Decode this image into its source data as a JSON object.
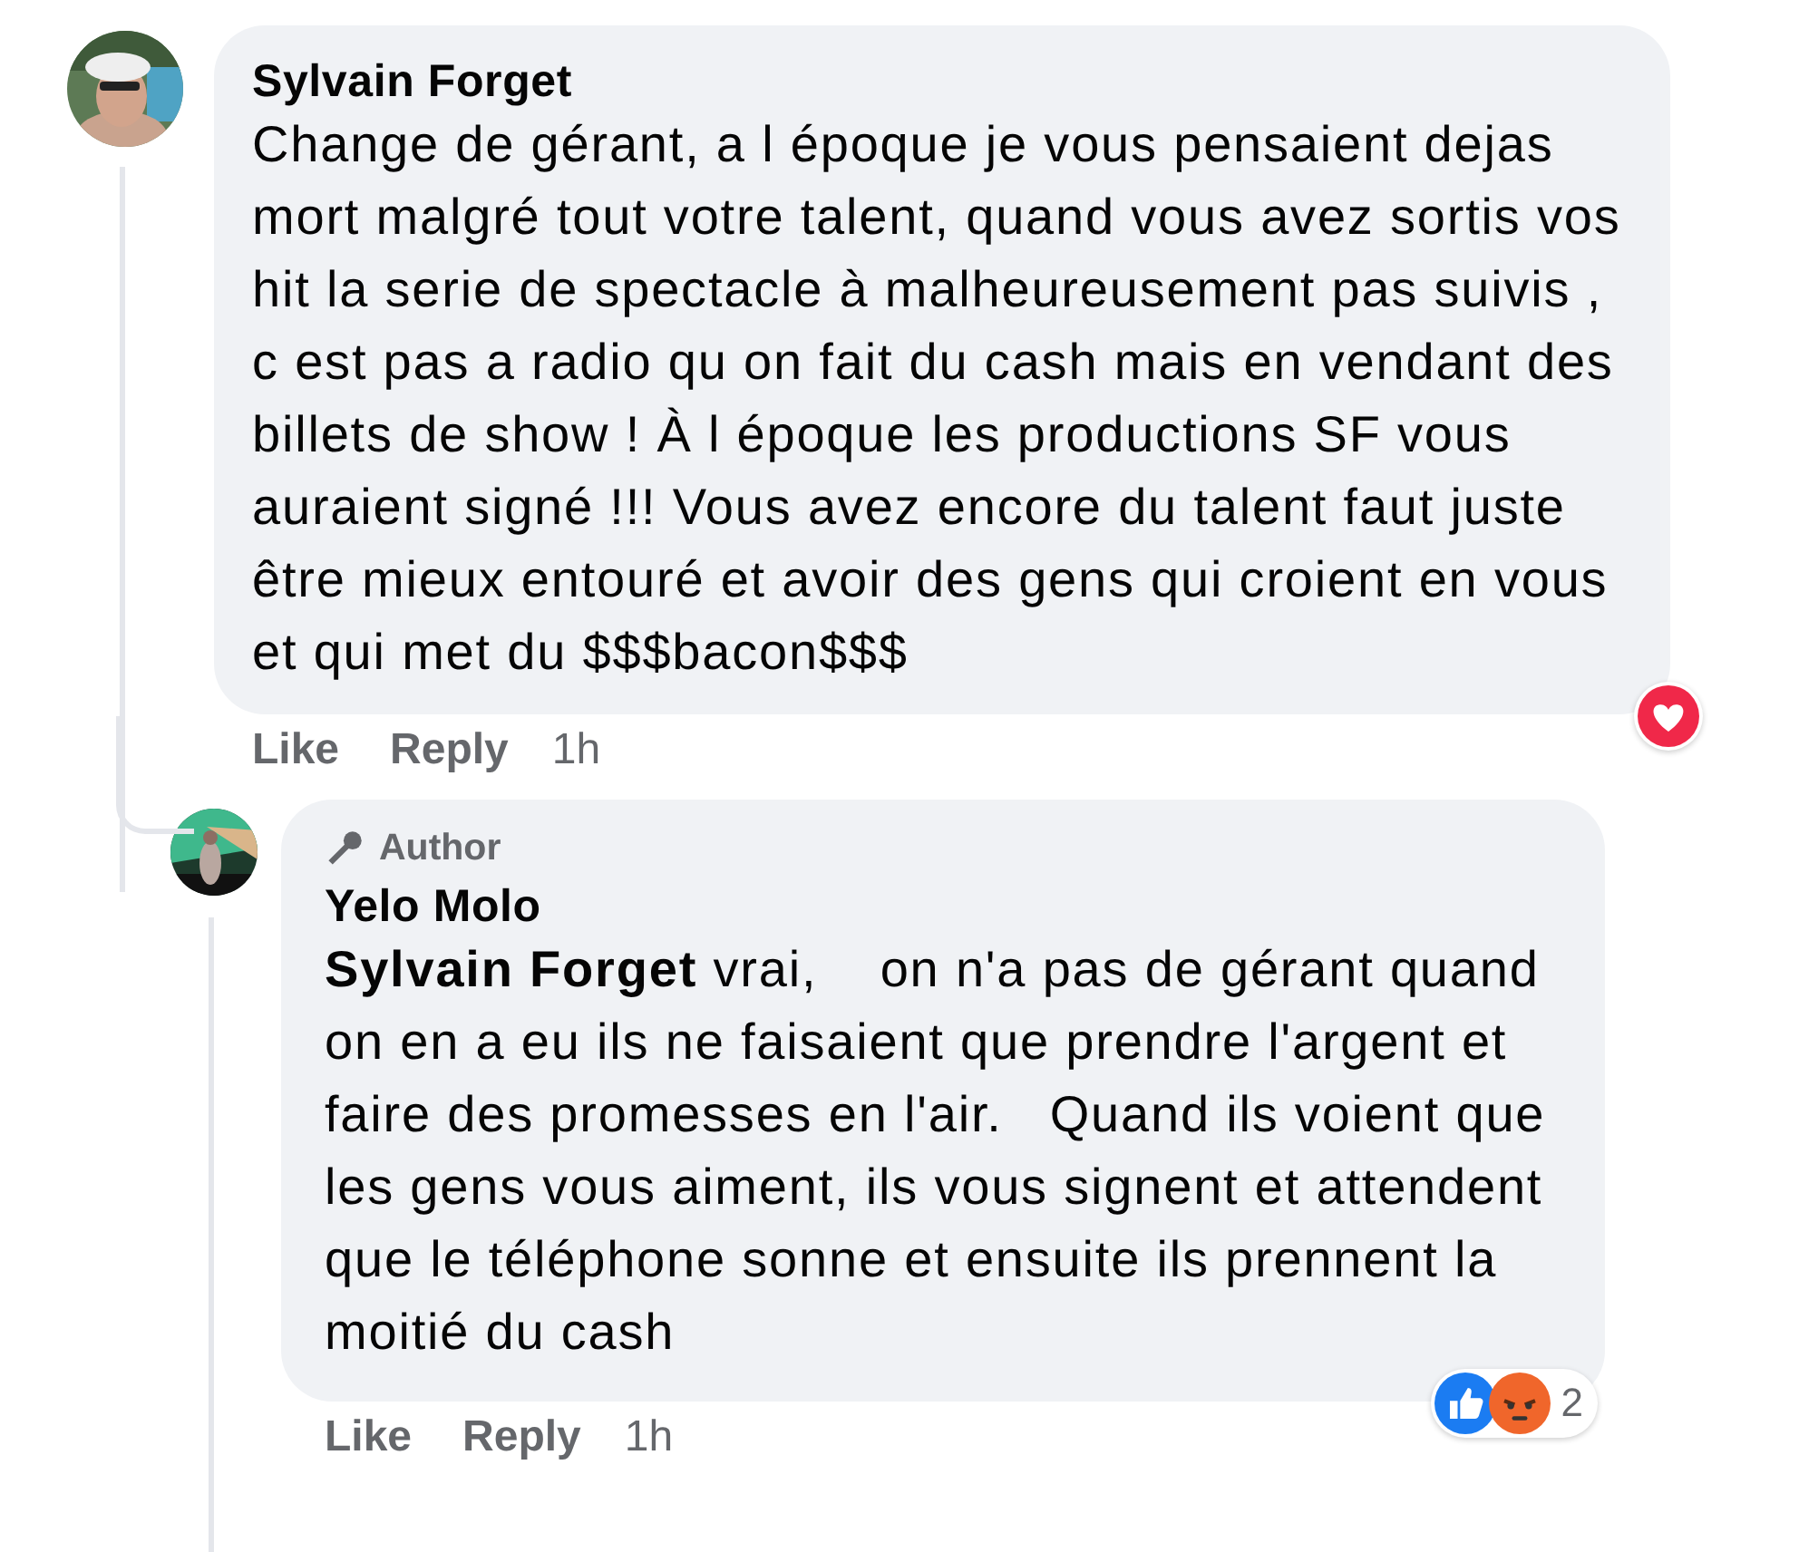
{
  "comment": {
    "author": "Sylvain Forget",
    "text": "Change de gérant, a l époque je vous pensaient dejas mort malgré tout votre talent, quand vous avez sortis vos hit la serie de spectacle à malheureusement pas suivis , c est pas a radio qu on fait du cash mais en vendant des billets de show ! À l époque les productions SF vous auraient signé !!! Vous avez encore du talent faut juste être mieux entouré et avoir des gens qui croient en vous et qui met du $$$bacon$$$",
    "reactions": [
      {
        "kind": "love"
      }
    ],
    "actions": [
      "Like",
      "Reply"
    ],
    "time": "1h",
    "replies": [
      {
        "badge": "Author",
        "author": "Yelo Molo",
        "text": "**Sylvain Forget** vrai,    on n'a pas de gérant quand on en a eu ils ne faisaient que prendre l'argent et faire des promesses en l'air.   Quand ils voient que les gens vous aiment, ils vous signent et attendent que le téléphone sonne et ensuite ils prennent la moitié du cash",
        "reactions": [
          {
            "kind": "like"
          },
          {
            "kind": "angry"
          }
        ],
        "reaction_count": "2",
        "actions": [
          "Like",
          "Reply"
        ],
        "time": "1h"
      }
    ]
  }
}
